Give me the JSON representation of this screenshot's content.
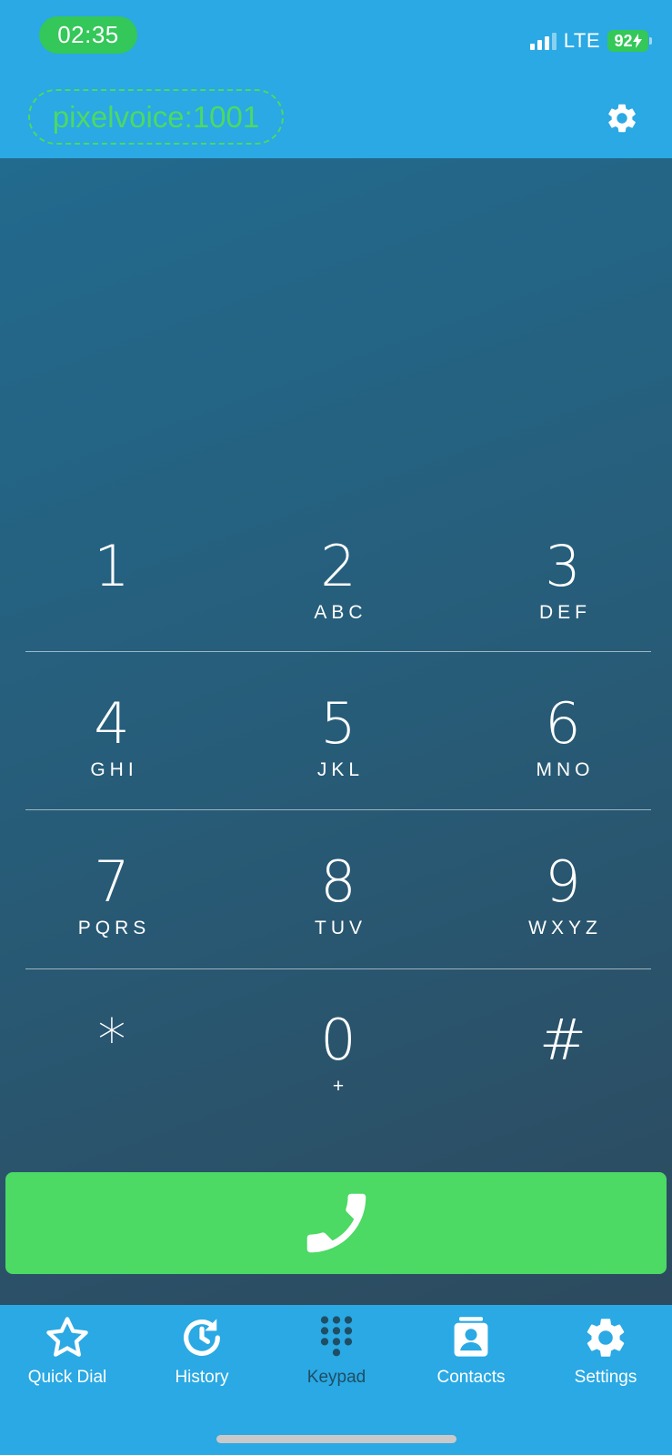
{
  "status_bar": {
    "time": "02:35",
    "network": "LTE",
    "battery": "92"
  },
  "header": {
    "account": "pixelvoice:1001",
    "settings_icon": "gear-icon"
  },
  "keypad": {
    "keys": [
      {
        "digit": "1",
        "letters": ""
      },
      {
        "digit": "2",
        "letters": "ABC"
      },
      {
        "digit": "3",
        "letters": "DEF"
      },
      {
        "digit": "4",
        "letters": "GHI"
      },
      {
        "digit": "5",
        "letters": "JKL"
      },
      {
        "digit": "6",
        "letters": "MNO"
      },
      {
        "digit": "7",
        "letters": "PQRS"
      },
      {
        "digit": "8",
        "letters": "TUV"
      },
      {
        "digit": "9",
        "letters": "WXYZ"
      },
      {
        "digit": "*",
        "letters": ""
      },
      {
        "digit": "0",
        "letters": "+"
      },
      {
        "digit": "#",
        "letters": ""
      }
    ],
    "call_icon": "phone-icon"
  },
  "tabs": [
    {
      "label": "Quick Dial",
      "icon": "star-icon",
      "active": false
    },
    {
      "label": "History",
      "icon": "history-icon",
      "active": false
    },
    {
      "label": "Keypad",
      "icon": "keypad-icon",
      "active": true
    },
    {
      "label": "Contacts",
      "icon": "contacts-icon",
      "active": false
    },
    {
      "label": "Settings",
      "icon": "gear-icon",
      "active": false
    }
  ],
  "colors": {
    "bar_blue": "#2aa9e4",
    "accent_green": "#4cd964",
    "active_tab": "#1f4e64"
  }
}
